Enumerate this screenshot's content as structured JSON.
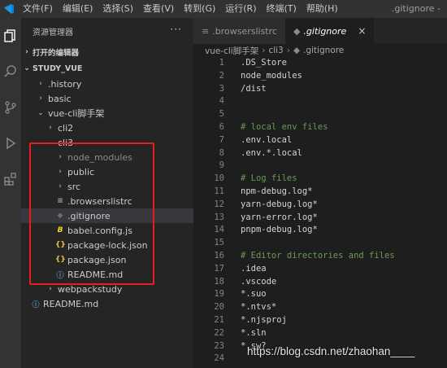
{
  "titlebar": {
    "menu": [
      "文件(F)",
      "编辑(E)",
      "选择(S)",
      "查看(V)",
      "转到(G)",
      "运行(R)",
      "终端(T)",
      "帮助(H)"
    ],
    "window_title": ".gitignore -"
  },
  "activity_bar": [
    "explorer-icon",
    "search-icon",
    "source-control-icon",
    "run-debug-icon",
    "extensions-icon"
  ],
  "sidebar": {
    "title": "资源管理器",
    "more": "···",
    "open_editors": "打开的编辑器",
    "project": "STUDY_VUE",
    "tree": [
      {
        "label": ".history",
        "type": "folder",
        "depth": 0
      },
      {
        "label": "basic",
        "type": "folder",
        "depth": 0
      },
      {
        "label": "vue-cli脚手架",
        "type": "folder-open",
        "depth": 0
      },
      {
        "label": "cli2",
        "type": "folder",
        "depth": 1
      },
      {
        "label": "cli3",
        "type": "folder-open",
        "depth": 1
      },
      {
        "label": "node_modules",
        "type": "folder",
        "depth": 2
      },
      {
        "label": "public",
        "type": "folder",
        "depth": 2
      },
      {
        "label": "src",
        "type": "folder",
        "depth": 2
      },
      {
        "label": ".browserslistrc",
        "type": "file",
        "depth": 2,
        "icon": "≡",
        "icon_color": "#a9a9a9"
      },
      {
        "label": ".gitignore",
        "type": "file",
        "depth": 2,
        "icon": "◆",
        "icon_color": "#6d6d6d"
      },
      {
        "label": "babel.config.js",
        "type": "file",
        "depth": 2,
        "icon": "𝘽",
        "icon_color": "#f5de19"
      },
      {
        "label": "package-lock.json",
        "type": "file",
        "depth": 2,
        "icon": "{}",
        "icon_color": "#e8c24a"
      },
      {
        "label": "package.json",
        "type": "file",
        "depth": 2,
        "icon": "{}",
        "icon_color": "#e8c24a"
      },
      {
        "label": "README.md",
        "type": "file",
        "depth": 2,
        "icon": "ⓘ",
        "icon_color": "#519aba"
      },
      {
        "label": "webpackstudy",
        "type": "folder",
        "depth": 1
      },
      {
        "label": "README.md",
        "type": "file",
        "depth": 0,
        "icon": "ⓘ",
        "icon_color": "#519aba"
      }
    ]
  },
  "tabs": [
    {
      "label": ".browserslistrc",
      "icon": "≡",
      "active": false
    },
    {
      "label": ".gitignore",
      "icon": "◆",
      "active": true,
      "close": "×"
    }
  ],
  "breadcrumb": [
    "vue-cli脚手架",
    "cli3",
    ".gitignore"
  ],
  "editor": {
    "lines": [
      {
        "n": "1",
        "text": ".DS_Store",
        "comment": false
      },
      {
        "n": "2",
        "text": "node_modules",
        "comment": false
      },
      {
        "n": "3",
        "text": "/dist",
        "comment": false
      },
      {
        "n": "4",
        "text": "",
        "comment": false
      },
      {
        "n": "5",
        "text": "",
        "comment": false
      },
      {
        "n": "6",
        "text": "# local env files",
        "comment": true
      },
      {
        "n": "7",
        "text": ".env.local",
        "comment": false
      },
      {
        "n": "8",
        "text": ".env.*.local",
        "comment": false
      },
      {
        "n": "9",
        "text": "",
        "comment": false
      },
      {
        "n": "10",
        "text": "# Log files",
        "comment": true
      },
      {
        "n": "11",
        "text": "npm-debug.log*",
        "comment": false
      },
      {
        "n": "12",
        "text": "yarn-debug.log*",
        "comment": false
      },
      {
        "n": "13",
        "text": "yarn-error.log*",
        "comment": false
      },
      {
        "n": "14",
        "text": "pnpm-debug.log*",
        "comment": false
      },
      {
        "n": "15",
        "text": "",
        "comment": false
      },
      {
        "n": "16",
        "text": "# Editor directories and files",
        "comment": true
      },
      {
        "n": "17",
        "text": ".idea",
        "comment": false
      },
      {
        "n": "18",
        "text": ".vscode",
        "comment": false
      },
      {
        "n": "19",
        "text": "*.suo",
        "comment": false
      },
      {
        "n": "20",
        "text": "*.ntvs*",
        "comment": false
      },
      {
        "n": "21",
        "text": "*.njsproj",
        "comment": false
      },
      {
        "n": "22",
        "text": "*.sln",
        "comment": false
      },
      {
        "n": "23",
        "text": "*.sw?",
        "comment": false
      },
      {
        "n": "24",
        "text": "",
        "comment": false
      }
    ]
  },
  "watermark": "https://blog.csdn.net/zhaohan____",
  "colors": {
    "highlight_border": "#e81e1e",
    "accent": "#007acc"
  }
}
